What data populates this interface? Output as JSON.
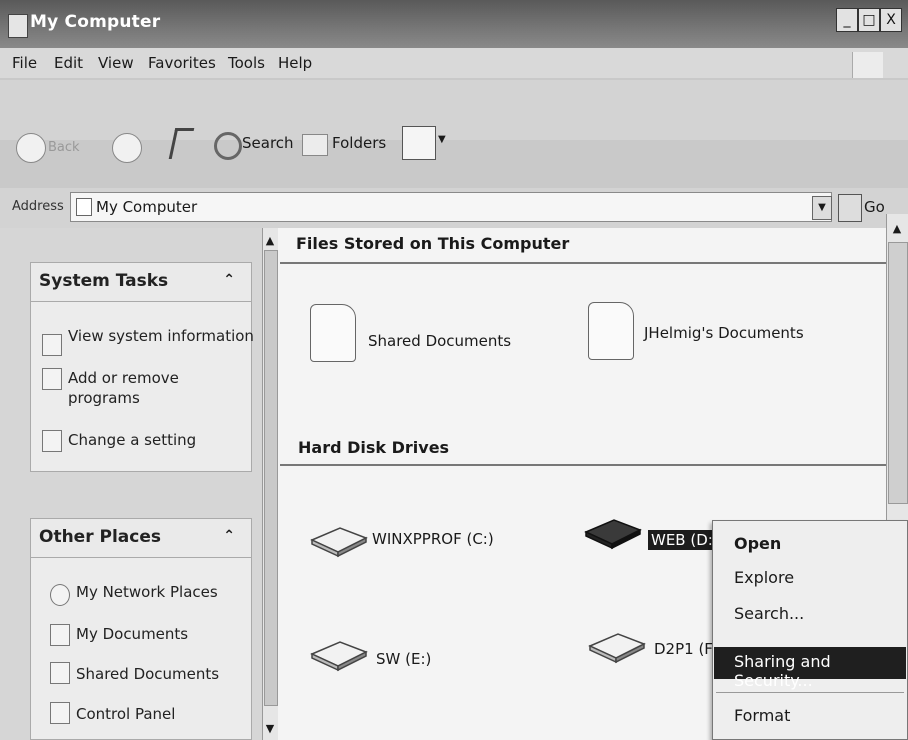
{
  "window": {
    "title": "My Computer",
    "controls": {
      "minimize": "_",
      "maximize": "□",
      "close": "X"
    }
  },
  "menu": [
    "File",
    "Edit",
    "View",
    "Favorites",
    "Tools",
    "Help"
  ],
  "toolbar": {
    "back_label": "Back",
    "search_label": "Search",
    "folders_label": "Folders"
  },
  "address": {
    "label": "Address",
    "value": "My Computer",
    "go_label": "Go"
  },
  "left_pane": {
    "system_tasks": {
      "title": "System Tasks",
      "items": [
        "View system information",
        "Add or remove programs",
        "Change a setting"
      ]
    },
    "other_places": {
      "title": "Other Places",
      "items": [
        "My Network Places",
        "My Documents",
        "Shared Documents",
        "Control Panel"
      ]
    }
  },
  "right_pane": {
    "files_section": {
      "title": "Files Stored on This Computer",
      "items": [
        "Shared Documents",
        "JHelmig's Documents"
      ]
    },
    "drives_section": {
      "title": "Hard Disk Drives",
      "items": [
        "WINXPPROF (C:)",
        "WEB (D:",
        "SW (E:)",
        "D2P1 (F:"
      ]
    }
  },
  "context_menu": {
    "items": [
      "Open",
      "Explore",
      "Search...",
      "Sharing and Security...",
      "Format"
    ],
    "selected": "Sharing and Security..."
  }
}
